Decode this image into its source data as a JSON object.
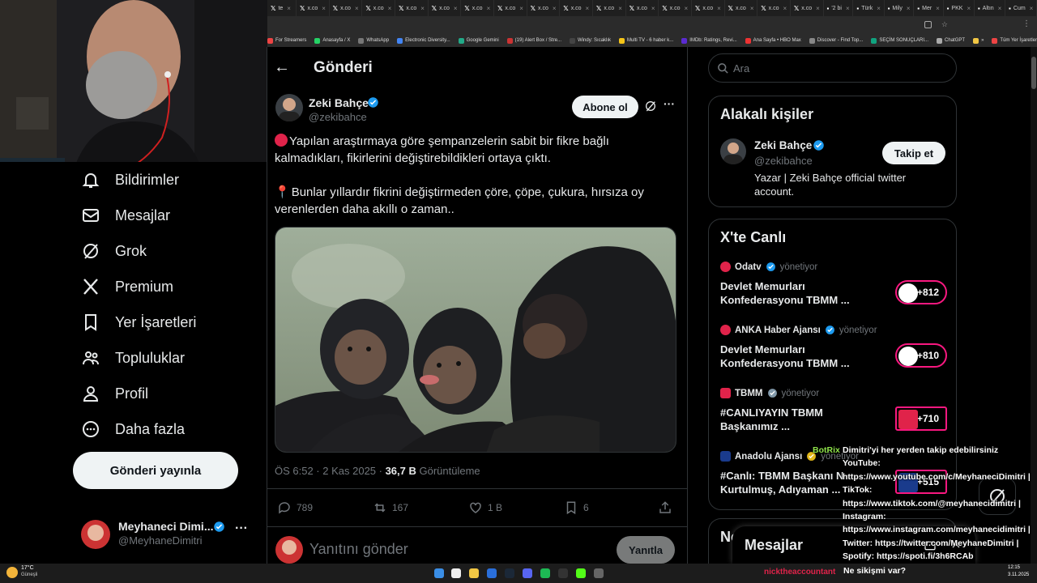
{
  "browser": {
    "tabs": [
      {
        "label": "te"
      },
      {
        "label": "x.co"
      },
      {
        "label": "x.co"
      },
      {
        "label": "x.co"
      },
      {
        "label": "x.co"
      },
      {
        "label": "x.co"
      },
      {
        "label": "x.co"
      },
      {
        "label": "x.co"
      },
      {
        "label": "x.co"
      },
      {
        "label": "x.co"
      },
      {
        "label": "x.co"
      },
      {
        "label": "x.co"
      },
      {
        "label": "x.co"
      },
      {
        "label": "x.co"
      },
      {
        "label": "x.co"
      },
      {
        "label": "x.co"
      },
      {
        "label": "x.co"
      },
      {
        "label": "'2 bi"
      },
      {
        "label": "Türk"
      },
      {
        "label": "Mily"
      },
      {
        "label": "Mer"
      },
      {
        "label": "PKK"
      },
      {
        "label": "Altın"
      },
      {
        "label": "Cum"
      }
    ],
    "bookmarks": [
      "For Streamers",
      "Anasayfa / X",
      "WhatsApp",
      "Electronic Diversity...",
      "Google Gemini",
      "(19) Alert Box / Stre...",
      "Windy: Sıcaklık",
      "Multi TV - 6 haber k...",
      "IMDb: Ratings, Revi...",
      "Ana Sayfa • HBO Max",
      "Discover - Find Top...",
      "SEÇİM SONUÇLARI...",
      "ChatGPT",
      "»",
      "Tüm Yer İşaretleri"
    ]
  },
  "nav": {
    "items": [
      {
        "label": "Bildirimler",
        "icon": "bell-icon"
      },
      {
        "label": "Mesajlar",
        "icon": "envelope-icon"
      },
      {
        "label": "Grok",
        "icon": "grok-icon"
      },
      {
        "label": "Premium",
        "icon": "x-logo-icon"
      },
      {
        "label": "Yer İşaretleri",
        "icon": "bookmark-icon"
      },
      {
        "label": "Topluluklar",
        "icon": "communities-icon"
      },
      {
        "label": "Profil",
        "icon": "person-icon"
      },
      {
        "label": "Daha fazla",
        "icon": "more-circle-icon"
      }
    ],
    "post_button": "Gönderi yayınla",
    "account": {
      "name": "Meyhaneci Dimi...",
      "handle": "@MeyhaneDimitri"
    }
  },
  "post": {
    "header_title": "Gönderi",
    "author": {
      "name": "Zeki Bahçe",
      "handle": "@zekibahce"
    },
    "follow_button": "Abone ol",
    "text_line1": "Yapılan araştırmaya göre şempanzelerin sabit bir fikre bağlı",
    "text_line2": "kalmadıkları, fikirlerini değiştirebildikleri ortaya çıktı.",
    "text_line3": "Bunlar yıllardır fikrini değiştirmeden çöre, çöpe, çukura, hırsıza oy",
    "text_line4": "verenlerden daha akıllı o zaman..",
    "time": "ÖS 6:52 · 2 Kas 2025 · ",
    "views": "36,7 B",
    "views_label": " Görüntüleme",
    "stats": {
      "replies": "789",
      "reposts": "167",
      "likes": "1 B",
      "bookmarks": "6"
    },
    "reply_placeholder": "Yanıtını gönder",
    "reply_button": "Yanıtla"
  },
  "right": {
    "search_placeholder": "Ara",
    "related_title": "Alakalı kişiler",
    "related": {
      "name": "Zeki Bahçe",
      "handle": "@zekibahce",
      "bio": "Yazar | Zeki Bahçe official twitter account.",
      "follow": "Takip et"
    },
    "live_title": "X'te Canlı",
    "live": [
      {
        "source": "Odatv",
        "status": "yönetiyor",
        "title1": "Devlet Memurları",
        "title2": "Konfederasyonu TBMM ...",
        "count": "+812"
      },
      {
        "source": "ANKA Haber Ajansı",
        "status": "yönetiyor",
        "title1": "Devlet Memurları",
        "title2": "Konfederasyonu TBMM ...",
        "count": "+810"
      },
      {
        "source": "TBMM",
        "status": "yönetiyor",
        "title1": "#CANLIYAYIN  TBMM",
        "title2": "Başkanımız ...",
        "count": "+710"
      },
      {
        "source": "Anadolu Ajansı",
        "status": "yönetiyor",
        "title1": "#Canlı: TBMM Başkanı N",
        "title2": "Kurtulmuş, Adıyaman ...",
        "count": "+515"
      }
    ],
    "messages_partial": "No",
    "messages_title": "Mesajlar"
  },
  "chat": {
    "bot_name": "BotRix",
    "lines": [
      "Dimitri'yi her yerden takip edebilirsiniz",
      "YouTube:",
      "https://www.youtube.com/c/MeyhaneciDimitri |",
      "TikTok:",
      "https://www.tiktok.com/@meyhanecidimitri |",
      "Instagram:",
      "https://www.instagram.com/meyhanecidimitri |",
      "Twitter: https://twitter.com/MeyhaneDimitri |",
      "Spotify: https://spoti.fi/3h6RCAb"
    ],
    "user2": "nicktheaccountant",
    "user2_msg": "Ne sikişmi var?"
  },
  "taskbar": {
    "weather_temp": "17°C",
    "weather_desc": "Güneşli",
    "time": "12:15",
    "date": "3.11.2025"
  },
  "colors": {
    "accent": "#1d9bf0",
    "live": "#f91880",
    "bg": "#000000",
    "text": "#e7e9ea",
    "muted": "#71767b"
  }
}
